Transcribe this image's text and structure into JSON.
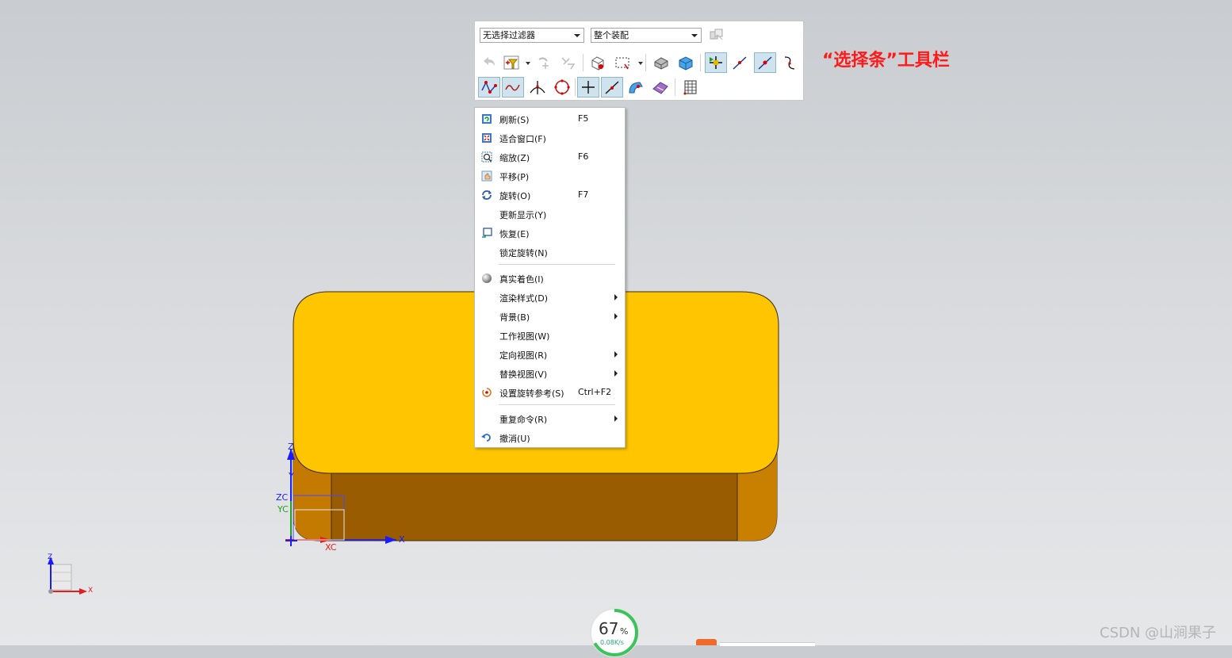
{
  "selection_bar": {
    "filter_value": "无选择过滤器",
    "scope_value": "整个装配"
  },
  "annotation": {
    "text": "“选择条”工具栏",
    "color": "#ff1a1a"
  },
  "context_menu": {
    "items": [
      {
        "label": "刷新(S)",
        "shortcut": "F5",
        "icon": "refresh-icon"
      },
      {
        "label": "适合窗口(F)",
        "shortcut": "",
        "icon": "fit-window-icon"
      },
      {
        "label": "缩放(Z)",
        "shortcut": "F6",
        "icon": "zoom-icon"
      },
      {
        "label": "平移(P)",
        "shortcut": "",
        "icon": "pan-icon"
      },
      {
        "label": "旋转(O)",
        "shortcut": "F7",
        "icon": "rotate-icon"
      },
      {
        "label": "更新显示(Y)",
        "shortcut": "",
        "icon": ""
      },
      {
        "label": "恢复(E)",
        "shortcut": "",
        "icon": "restore-icon"
      },
      {
        "label": "锁定旋转(N)",
        "shortcut": "",
        "icon": ""
      },
      {
        "label": "真实着色(I)",
        "shortcut": "",
        "icon": "true-shading-icon"
      },
      {
        "label": "渲染样式(D)",
        "shortcut": "",
        "icon": "",
        "submenu": true
      },
      {
        "label": "背景(B)",
        "shortcut": "",
        "icon": "",
        "submenu": true
      },
      {
        "label": "工作视图(W)",
        "shortcut": "",
        "icon": ""
      },
      {
        "label": "定向视图(R)",
        "shortcut": "",
        "icon": "",
        "submenu": true
      },
      {
        "label": "替换视图(V)",
        "shortcut": "",
        "icon": "",
        "submenu": true
      },
      {
        "label": "设置旋转参考(S)",
        "shortcut": "Ctrl+F2",
        "icon": "rotate-reference-icon"
      },
      {
        "label": "重复命令(R)",
        "shortcut": "",
        "icon": "",
        "submenu": true
      },
      {
        "label": "撤消(U)",
        "shortcut": "",
        "icon": "undo-icon"
      }
    ]
  },
  "model_view": {
    "part_top_color": "#ffc600",
    "part_side_color": "#9a5c00",
    "csys_labels": {
      "z": "Z",
      "y": "Y",
      "zc": "ZC",
      "yc": "YC",
      "xc": "XC",
      "x": "X"
    }
  },
  "triad": {
    "z": "Z",
    "x": "X"
  },
  "status": {
    "progress_percent": 67,
    "progress_value": "67",
    "progress_unit": "%",
    "progress_sub": "0.08K/s"
  },
  "watermark": "CSDN @山涧果子"
}
